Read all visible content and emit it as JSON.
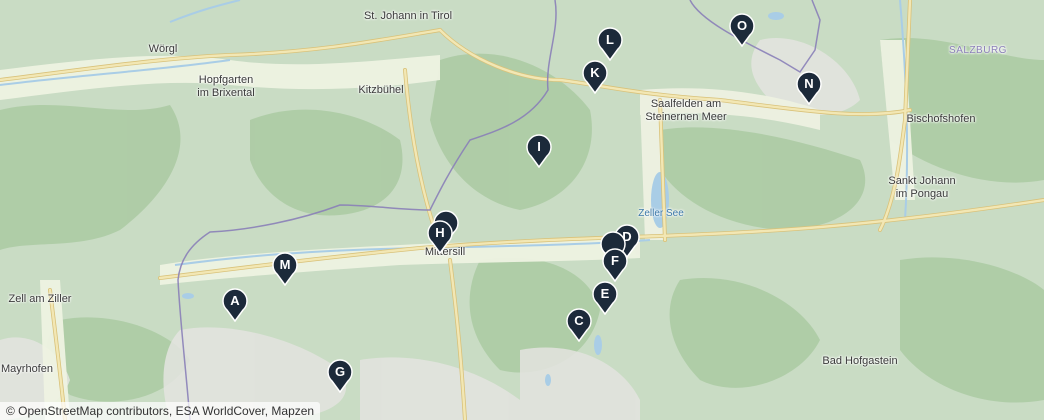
{
  "map": {
    "colors": {
      "terrain": "#c9dcc4",
      "valley": "#eef2e2",
      "forest": "#a9c9a0",
      "rock": "#e4e4e0",
      "water": "#a9cde6",
      "road": "#f2e7b4",
      "road_edge": "#d9c27a",
      "border": "#8a7fb8",
      "marker": "#1c2a3a"
    },
    "places": [
      {
        "id": "woergl",
        "name": "Wörgl"
      },
      {
        "id": "st-johann-in-tirol",
        "name": "St. Johann in Tirol"
      },
      {
        "id": "hopfgarten",
        "name": "Hopfgarten\nim Brixental"
      },
      {
        "id": "kitzbuehel",
        "name": "Kitzbühel"
      },
      {
        "id": "saalfelden",
        "name": "Saalfelden am\nSteinernen Meer"
      },
      {
        "id": "salzburg",
        "name": "SALZBURG"
      },
      {
        "id": "bischofshofen",
        "name": "Bischofshofen"
      },
      {
        "id": "sankt-johann-im-pongau",
        "name": "Sankt Johann\nim Pongau"
      },
      {
        "id": "zeller-see",
        "name": "Zeller See"
      },
      {
        "id": "mittersill",
        "name": "Mittersill"
      },
      {
        "id": "zell-am-ziller",
        "name": "Zell am Ziller"
      },
      {
        "id": "mayrhofen",
        "name": "Mayrhofen"
      },
      {
        "id": "bad-hofgastein",
        "name": "Bad Hofgastein"
      }
    ],
    "markers": [
      {
        "id": "A",
        "label": "A"
      },
      {
        "id": "C",
        "label": "C"
      },
      {
        "id": "D",
        "label": "D"
      },
      {
        "id": "E",
        "label": "E"
      },
      {
        "id": "F",
        "label": "F"
      },
      {
        "id": "G",
        "label": "G"
      },
      {
        "id": "H",
        "label": "H"
      },
      {
        "id": "I",
        "label": "I"
      },
      {
        "id": "K",
        "label": "K"
      },
      {
        "id": "L",
        "label": "L"
      },
      {
        "id": "M",
        "label": "M"
      },
      {
        "id": "N",
        "label": "N"
      },
      {
        "id": "O",
        "label": "O"
      }
    ],
    "attribution": "© OpenStreetMap contributors, ESA WorldCover, Mapzen"
  }
}
